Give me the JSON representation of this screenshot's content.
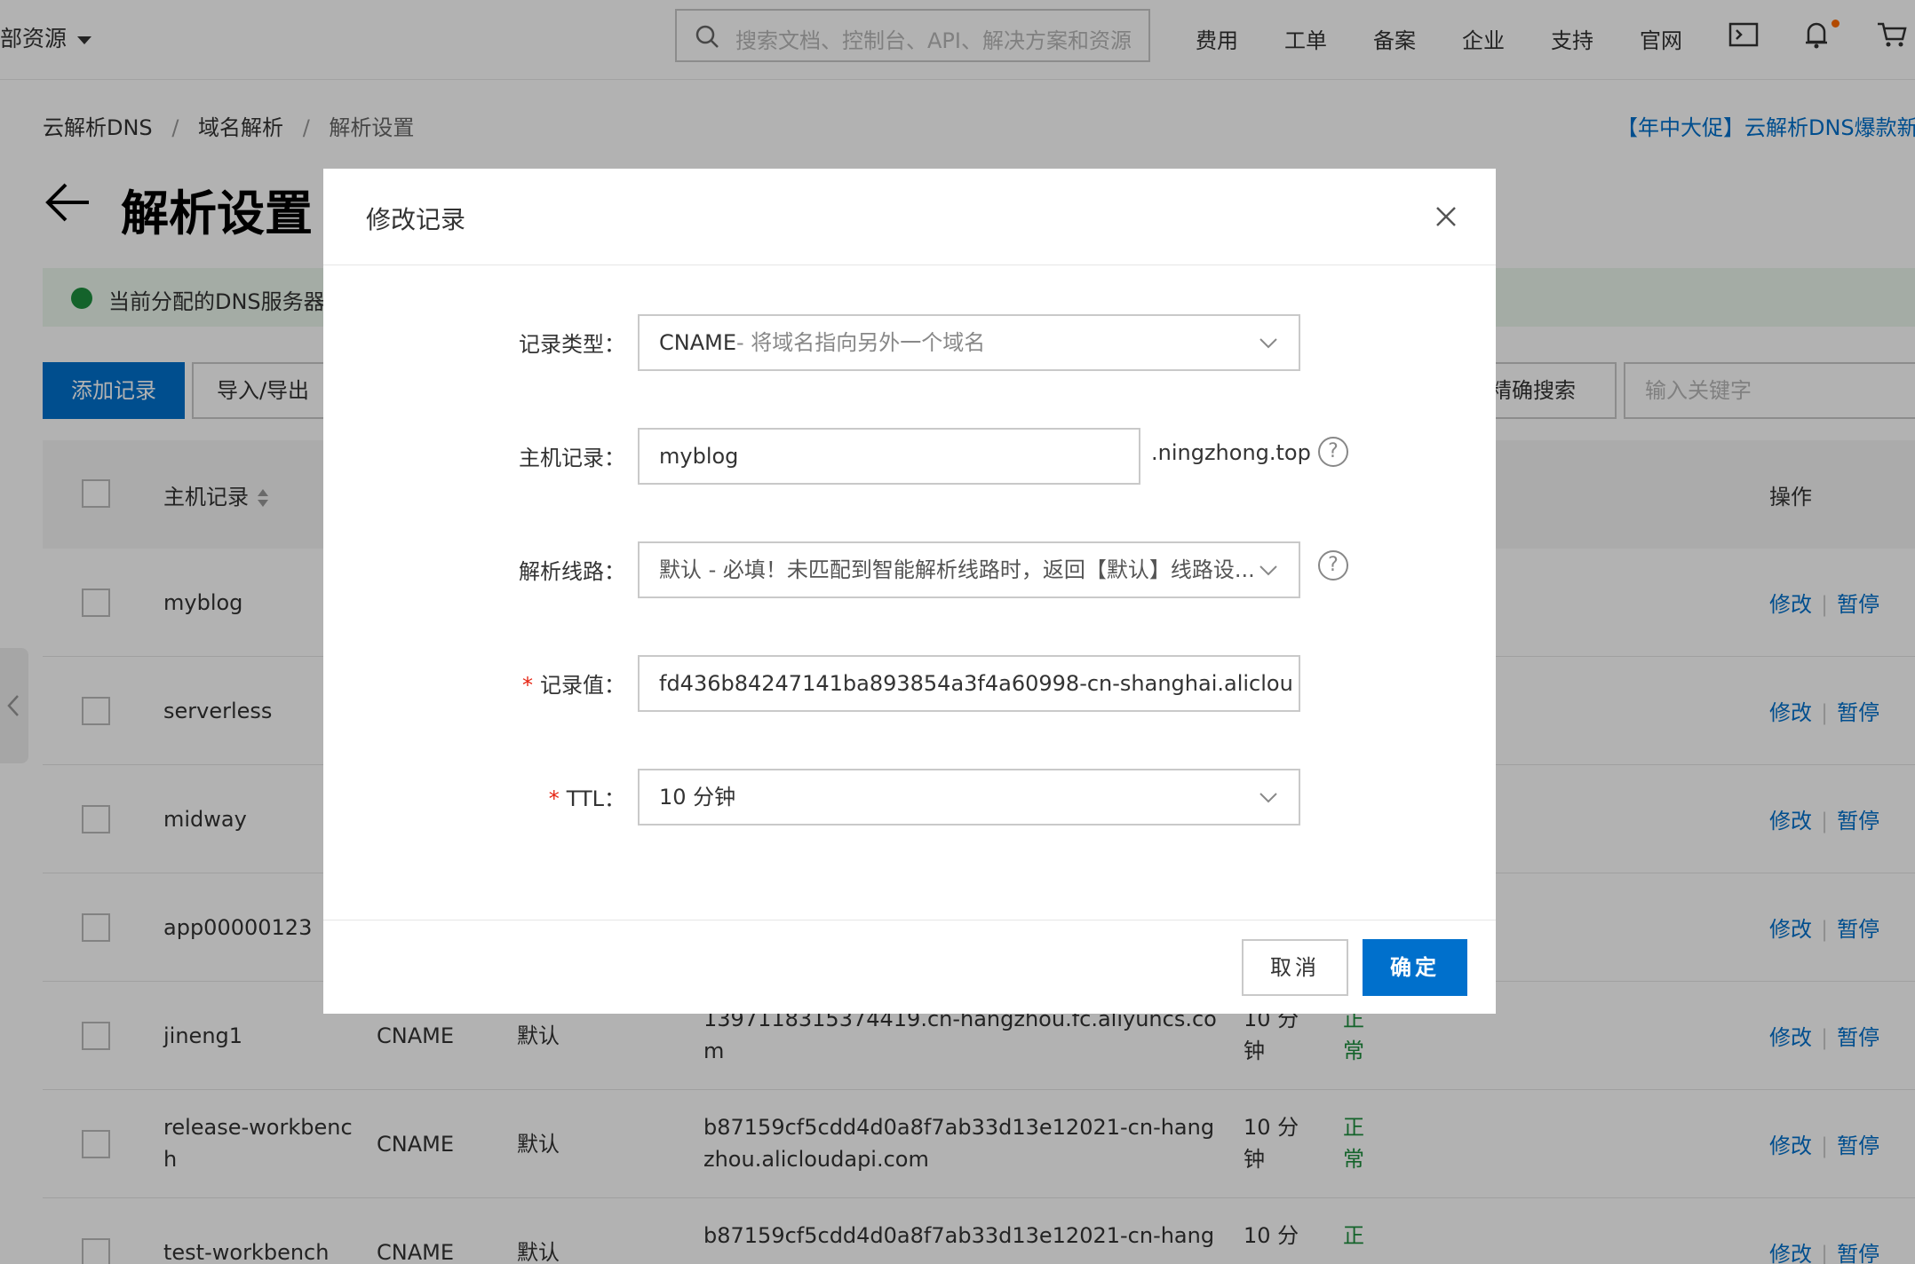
{
  "topbar": {
    "left_label": "部资源",
    "search_placeholder": "搜索文档、控制台、API、解决方案和资源",
    "nav": [
      "费用",
      "工单",
      "备案",
      "企业",
      "支持",
      "官网"
    ]
  },
  "breadcrumb": [
    "云解析DNS",
    "/",
    "域名解析",
    "/",
    "解析设置"
  ],
  "promo": "【年中大促】云解析DNS爆款新",
  "page_title": "解析设置",
  "alert_text": "当前分配的DNS服务器",
  "toolbar": {
    "add_label": "添加记录",
    "import_label": "导入/导出",
    "search_mode": "精确搜索",
    "keyword_placeholder": "输入关键字"
  },
  "table": {
    "headers": {
      "host": "主机记录",
      "ops": "操作"
    },
    "rows": [
      {
        "host": "myblog",
        "type": "",
        "line": "",
        "value": "",
        "ttl": "",
        "status": ""
      },
      {
        "host": "serverless",
        "type": "",
        "line": "",
        "value": "",
        "ttl": "",
        "status": ""
      },
      {
        "host": "midway",
        "type": "",
        "line": "",
        "value": "",
        "ttl": "",
        "status": ""
      },
      {
        "host": "app00000123",
        "type": "",
        "line": "",
        "value": "",
        "ttl": "",
        "status": ""
      },
      {
        "host": "jineng1",
        "type": "CNAME",
        "line": "默认",
        "value": "1397118315374419.cn-hangzhou.fc.aliyuncs.co m",
        "ttl": "10 分 钟",
        "status": "正 常"
      },
      {
        "host": "release-workbenc h",
        "type": "CNAME",
        "line": "默认",
        "value": "b87159cf5cdd4d0a8f7ab33d13e12021-cn-hang zhou.alicloudapi.com",
        "ttl": "10 分 钟",
        "status": "正 常"
      },
      {
        "host": "test-workbench",
        "type": "CNAME",
        "line": "默认",
        "value": "b87159cf5cdd4d0a8f7ab33d13e12021-cn-hang",
        "ttl": "10 分",
        "status": "正"
      }
    ],
    "action_edit": "修改",
    "action_pause": "暂停"
  },
  "modal": {
    "title": "修改记录",
    "record_type_label": "记录类型：",
    "record_type_value": "CNAME",
    "record_type_desc": "- 将域名指向另外一个域名",
    "host_label": "主机记录：",
    "host_value": "myblog",
    "host_suffix": ".ningzhong.top",
    "line_label": "解析线路：",
    "line_value": "默认 - 必填！未匹配到智能解析线路时，返回【默认】线路设...",
    "value_label": "记录值：",
    "value_value": "fd436b84247141ba893854a3f4a60998-cn-shanghai.aliclou",
    "ttl_label": "TTL：",
    "ttl_value": "10 分钟",
    "help_glyph": "?",
    "required_mark": "*",
    "cancel_label": "取消",
    "ok_label": "确定"
  },
  "colors": {
    "primary": "#0070cc",
    "success": "#1e8e3e",
    "required": "#e62412",
    "notify_dot": "#ff6a00"
  }
}
